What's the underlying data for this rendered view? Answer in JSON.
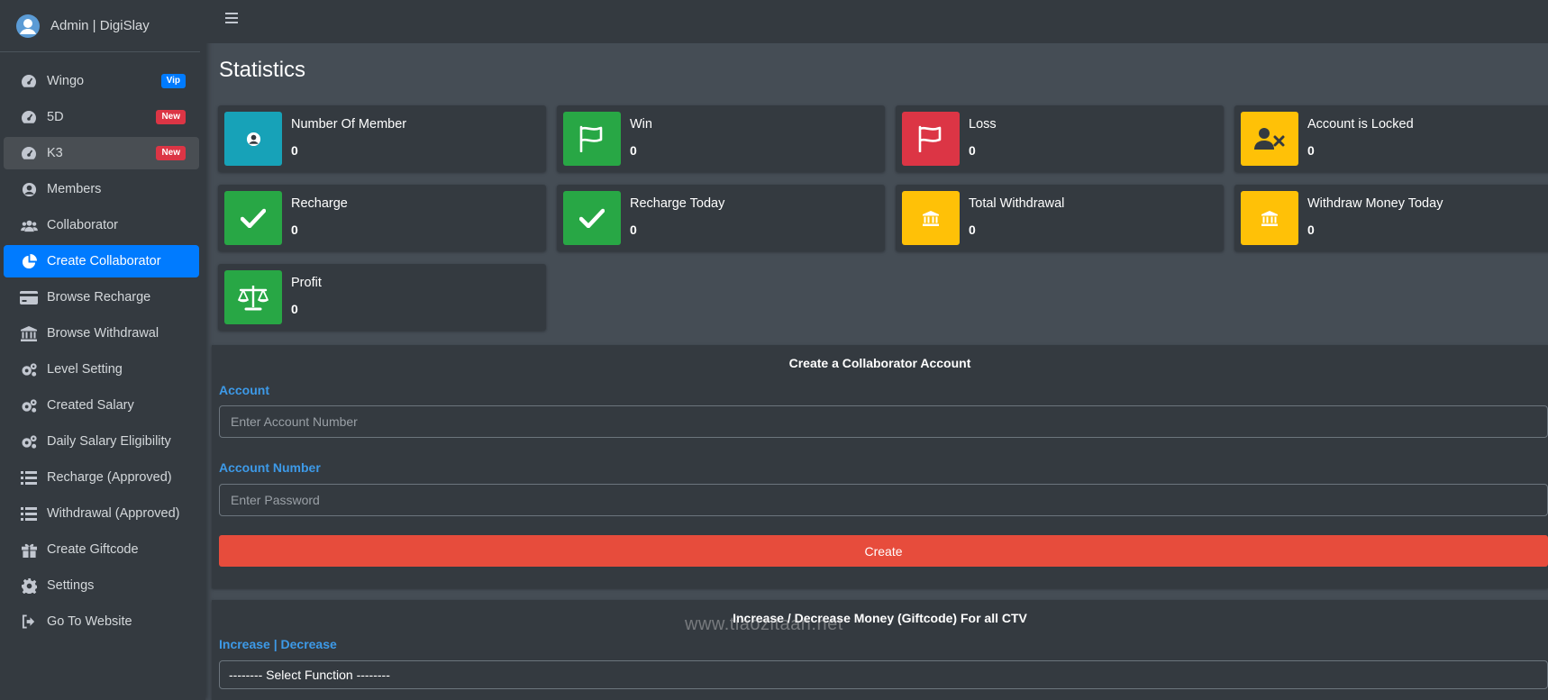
{
  "brand": {
    "title": "Admin | DigiSlay"
  },
  "sidebar": {
    "items": [
      {
        "label": "Wingo",
        "icon": "dashboard-gauge-icon",
        "badge": "Vip",
        "badge_color": "#007bff"
      },
      {
        "label": "5D",
        "icon": "dashboard-gauge-icon",
        "badge": "New",
        "badge_color": "#dc3545"
      },
      {
        "label": "K3",
        "icon": "dashboard-gauge-icon",
        "badge": "New",
        "badge_color": "#dc3545",
        "state": "hover"
      },
      {
        "label": "Members",
        "icon": "user-circle-icon"
      },
      {
        "label": "Collaborator",
        "icon": "users-icon"
      },
      {
        "label": "Create Collaborator",
        "icon": "pie-chart-icon",
        "state": "active"
      },
      {
        "label": "Browse Recharge",
        "icon": "credit-card-icon"
      },
      {
        "label": "Browse Withdrawal",
        "icon": "bank-icon"
      },
      {
        "label": "Level Setting",
        "icon": "cogs-icon"
      },
      {
        "label": "Created Salary",
        "icon": "cogs-icon"
      },
      {
        "label": "Daily Salary Eligibility",
        "icon": "cogs-icon"
      },
      {
        "label": "Recharge (Approved)",
        "icon": "list-icon"
      },
      {
        "label": "Withdrawal (Approved)",
        "icon": "list-icon"
      },
      {
        "label": "Create Giftcode",
        "icon": "gift-icon"
      },
      {
        "label": "Settings",
        "icon": "gear-icon"
      },
      {
        "label": "Go To Website",
        "icon": "sign-out-icon"
      }
    ]
  },
  "page": {
    "title": "Statistics"
  },
  "stats": [
    {
      "label": "Number Of Member",
      "value": "0",
      "icon": "user-circle-icon",
      "color": "#17a2b8"
    },
    {
      "label": "Win",
      "value": "0",
      "icon": "flag-icon",
      "color": "#28a745"
    },
    {
      "label": "Loss",
      "value": "0",
      "icon": "flag-icon",
      "color": "#dc3545"
    },
    {
      "label": "Account is Locked",
      "value": "0",
      "icon": "user-times-icon",
      "color": "#ffc107"
    },
    {
      "label": "Recharge",
      "value": "0",
      "icon": "check-icon",
      "color": "#28a745"
    },
    {
      "label": "Recharge Today",
      "value": "0",
      "icon": "check-icon",
      "color": "#28a745"
    },
    {
      "label": "Total Withdrawal",
      "value": "0",
      "icon": "bank-icon",
      "color": "#ffc107"
    },
    {
      "label": "Withdraw Money Today",
      "value": "0",
      "icon": "bank-icon",
      "color": "#ffc107"
    },
    {
      "label": "Profit",
      "value": "0",
      "icon": "balance-scale-icon",
      "color": "#28a745"
    }
  ],
  "create_form": {
    "title": "Create a Collaborator Account",
    "account_label": "Account",
    "account_placeholder": "Enter Account Number",
    "account_number_label": "Account Number",
    "password_placeholder": "Enter Password",
    "create_label": "Create"
  },
  "money_form": {
    "title": "Increase / Decrease Money (Giftcode) For all CTV",
    "label": "Increase | Decrease",
    "select_value": "-------- Select Function --------"
  },
  "watermark": "www.tiaozitaan.net"
}
